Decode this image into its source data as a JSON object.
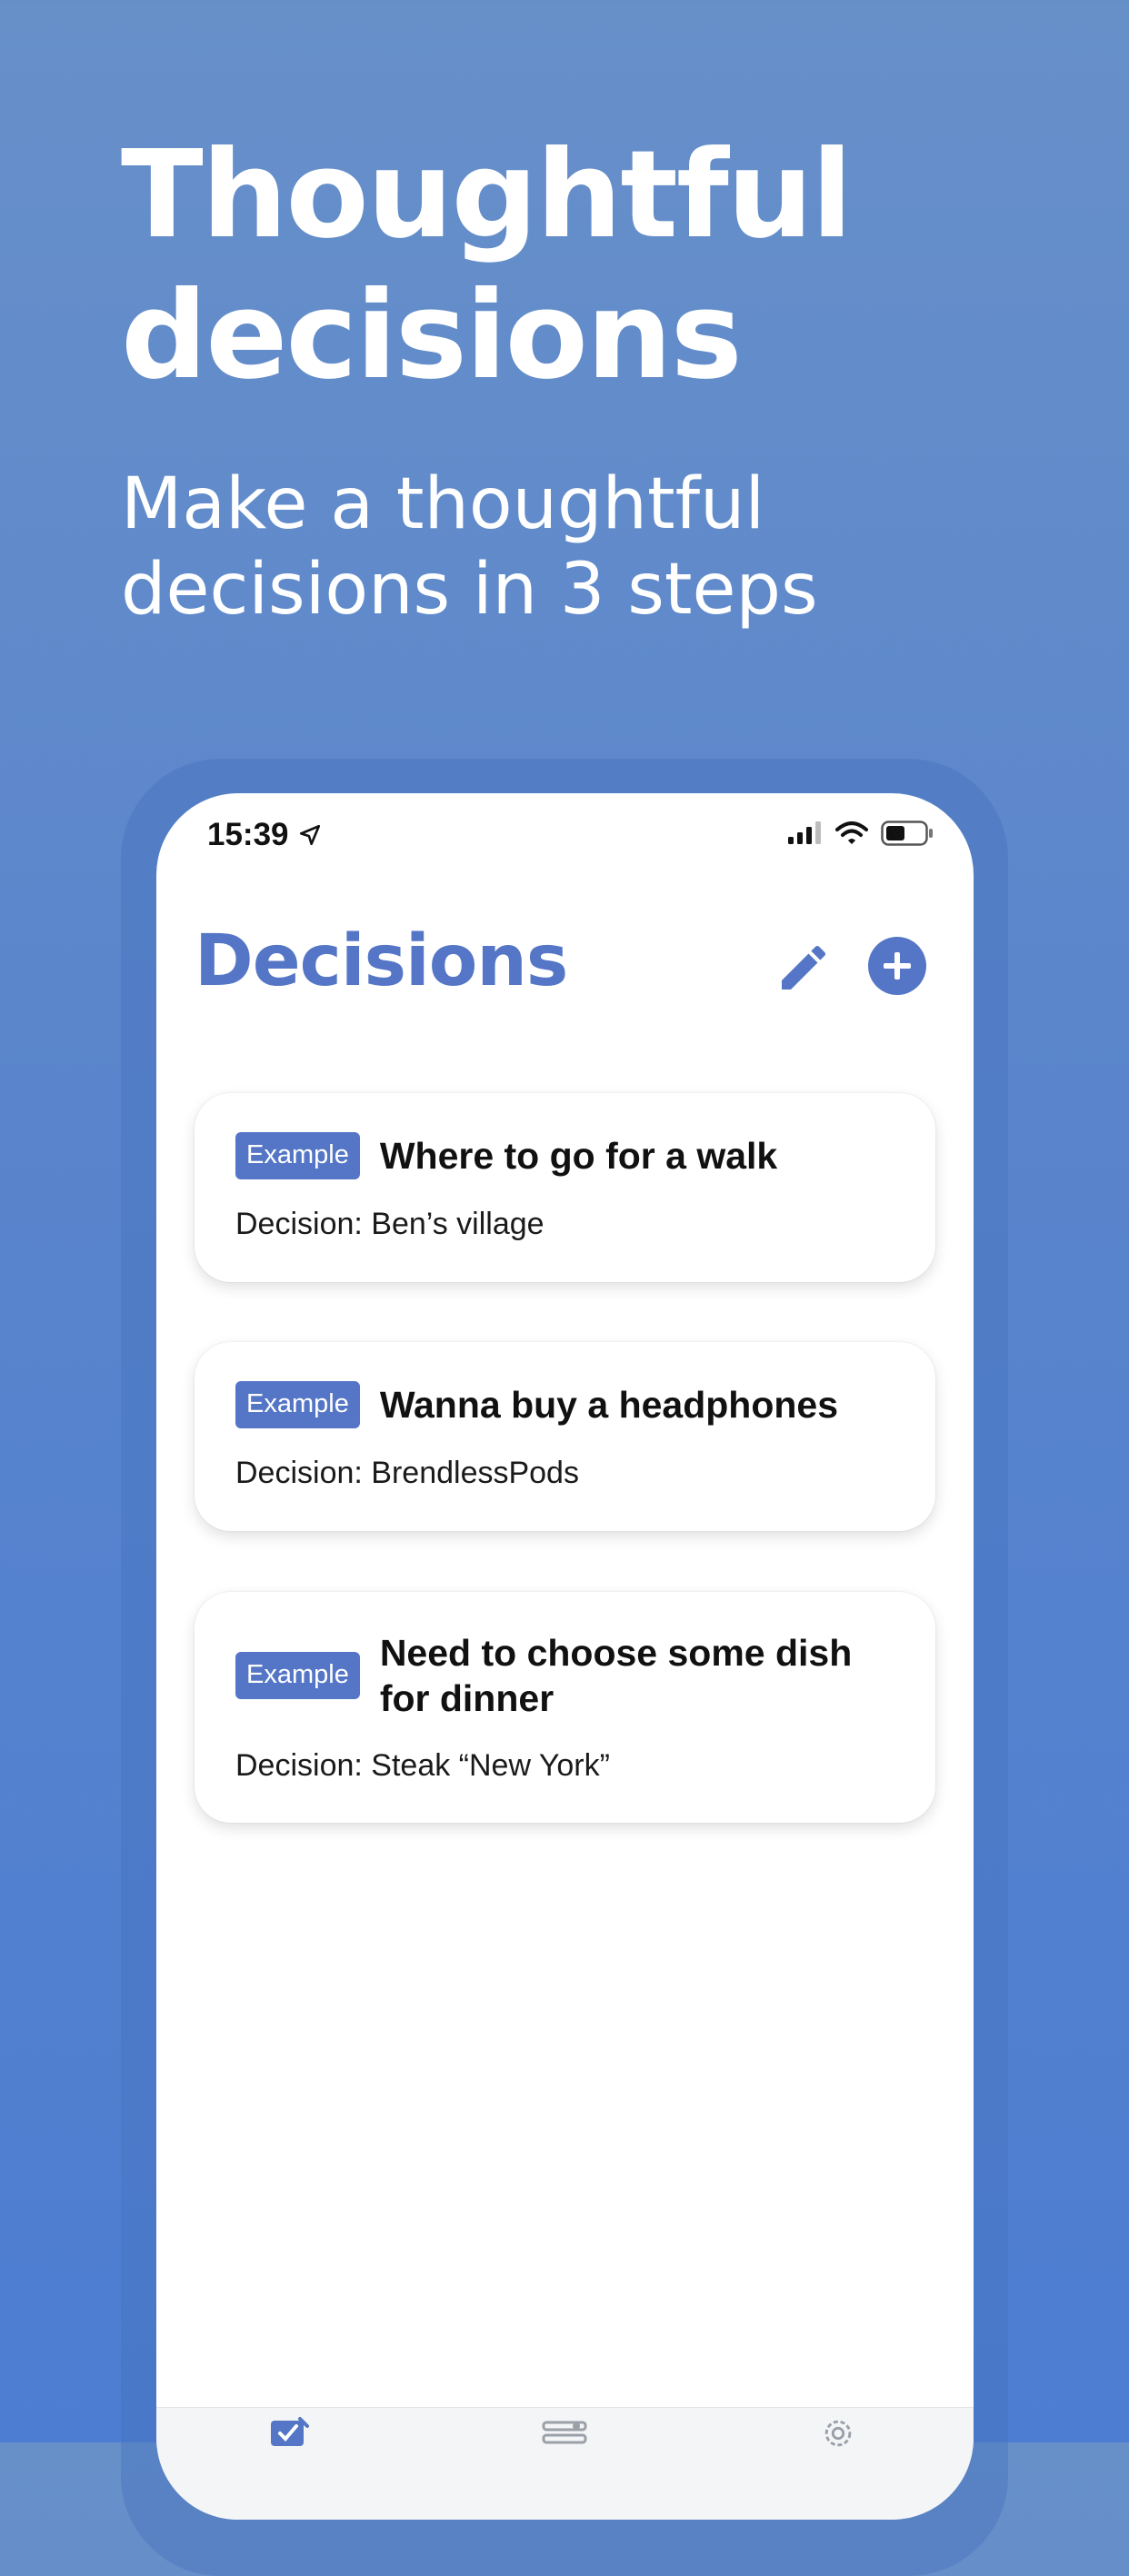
{
  "promo": {
    "headline_line1": "Thoughtful",
    "headline_line2": "decisions",
    "subhead_line1": "Make a thoughtful",
    "subhead_line2": "decisions in 3 steps"
  },
  "status_bar": {
    "time": "15:39",
    "icons": [
      "location-arrow-icon",
      "cellular-signal-icon",
      "wifi-icon",
      "battery-icon"
    ]
  },
  "header": {
    "title": "Decisions",
    "edit_icon": "pencil-icon",
    "add_icon": "plus-circle-icon"
  },
  "decisions": [
    {
      "badge": "Example",
      "title": "Where to go for a walk",
      "decision": "Decision: Ben’s village"
    },
    {
      "badge": "Example",
      "title": "Wanna buy a headphones",
      "decision": "Decision: BrendlessPods"
    },
    {
      "badge": "Example",
      "title": "Need to choose some dish for dinner",
      "decision": "Decision: Steak “New York”"
    }
  ],
  "tab_bar": {
    "tabs": [
      {
        "icon": "decisions-tab-icon",
        "active": true
      },
      {
        "icon": "lists-tab-icon",
        "active": false
      },
      {
        "icon": "gear-icon",
        "active": false
      }
    ]
  },
  "colors": {
    "accent": "#5576c6",
    "background_top": "#6790c9",
    "background_bottom": "#4d7dd2"
  }
}
